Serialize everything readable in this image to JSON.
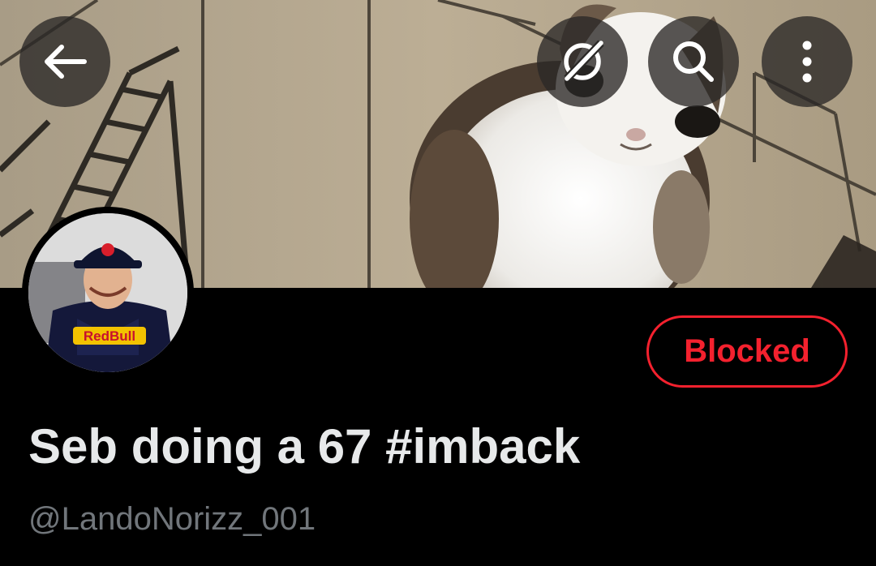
{
  "profile": {
    "display_name": "Seb doing a 67 #imback",
    "handle": "@LandoNorizz_001",
    "block_status_label": "Blocked",
    "banner_image": "cat meme banner",
    "avatar_image": "racing driver in Red Bull suit and cap",
    "avatar_suit_text": "RedBull"
  },
  "top_bar": {
    "back_icon": "arrow-left-icon",
    "grok_icon": "grok-icon",
    "search_icon": "search-icon",
    "more_icon": "more-vertical-icon"
  },
  "colors": {
    "background": "#000000",
    "name_text": "#e7e9ea",
    "handle_text": "#71767b",
    "blocked_red": "#f4212e",
    "overlay_button": "#2a2826"
  }
}
